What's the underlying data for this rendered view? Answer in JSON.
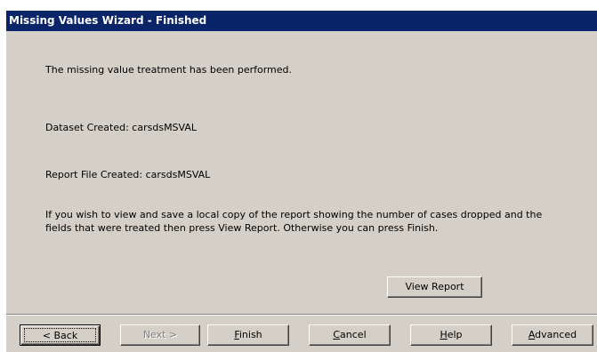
{
  "window": {
    "title": "Missing Values Wizard - Finished"
  },
  "content": {
    "status_message": "The missing value treatment has been performed.",
    "dataset_created": "Dataset Created: carsdsMSVAL",
    "report_file_created": "Report File Created: carsdsMSVAL",
    "info_message": "If you wish to view and save a local copy of the report showing the number of cases dropped and the fields that were treated then press View Report. Otherwise you can press Finish."
  },
  "buttons": {
    "view_report": "View Report",
    "back": "< Back",
    "next": "Next >",
    "finish": "Finish",
    "cancel": "Cancel",
    "help": "Help",
    "advanced": "Advanced"
  },
  "colors": {
    "title_bar": "#0a246a",
    "dialog_face": "#d4d0c8"
  }
}
